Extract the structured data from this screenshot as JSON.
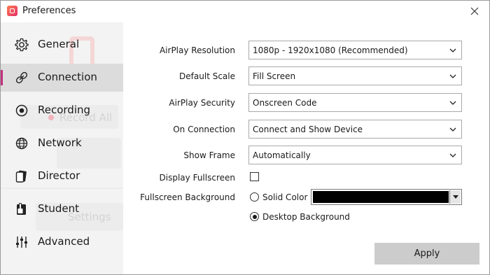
{
  "window": {
    "title": "Preferences",
    "accent": "#c0307e"
  },
  "sidebar": {
    "items": [
      {
        "label": "General",
        "icon": "gear-icon",
        "active": false
      },
      {
        "label": "Connection",
        "icon": "link-icon",
        "active": true
      },
      {
        "label": "Recording",
        "icon": "record-icon",
        "active": false
      },
      {
        "label": "Network",
        "icon": "globe-icon",
        "active": false
      },
      {
        "label": "Director",
        "icon": "director-icon",
        "active": false
      },
      {
        "label": "Student",
        "icon": "student-icon",
        "active": false
      },
      {
        "label": "Advanced",
        "icon": "sliders-icon",
        "active": false
      }
    ],
    "background_ghost": {
      "record_all": "Record All",
      "settings": "Settings"
    }
  },
  "form": {
    "airplay_resolution": {
      "label": "AirPlay Resolution",
      "value": "1080p - 1920x1080 (Recommended)"
    },
    "default_scale": {
      "label": "Default Scale",
      "value": "Fill Screen"
    },
    "airplay_security": {
      "label": "AirPlay Security",
      "value": "Onscreen Code"
    },
    "on_connection": {
      "label": "On Connection",
      "value": "Connect and Show Device"
    },
    "show_frame": {
      "label": "Show Frame",
      "value": "Automatically"
    },
    "display_fullscreen": {
      "label": "Display Fullscreen",
      "checked": false
    },
    "fullscreen_background": {
      "label": "Fullscreen Background",
      "options": [
        {
          "label": "Solid Color",
          "selected": false
        },
        {
          "label": "Desktop Background",
          "selected": true
        }
      ],
      "solid_color": "#000000"
    }
  },
  "footer": {
    "apply_label": "Apply"
  }
}
